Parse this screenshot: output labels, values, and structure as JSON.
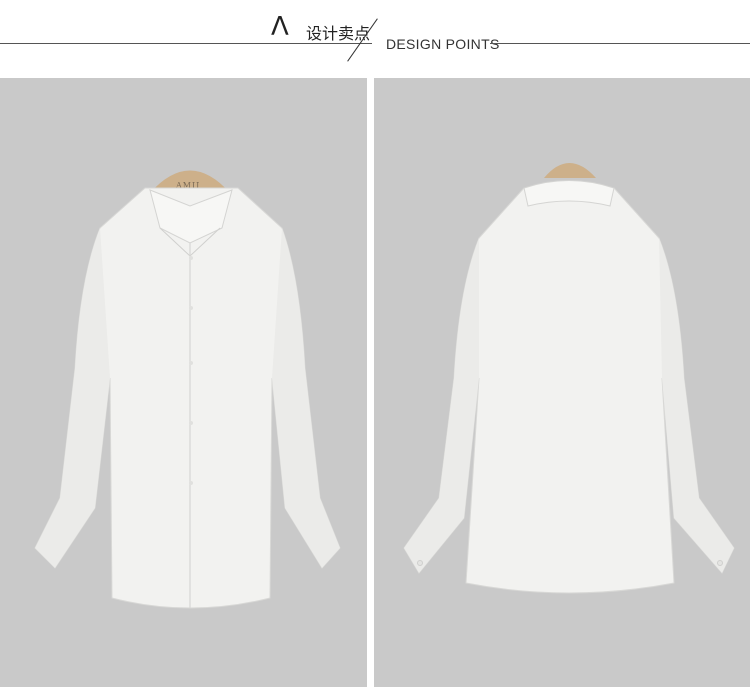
{
  "header": {
    "icon": "lambda-icon",
    "title_cn": "设计卖点",
    "title_en": "DESIGN  POINTS"
  },
  "images": {
    "front": {
      "description_icon": "shirt-front-icon",
      "hanger_brand": "AMII"
    },
    "back": {
      "description_icon": "shirt-back-icon"
    }
  },
  "colors": {
    "background_panel": "#c9c9c9",
    "shirt": "#f2f2f0",
    "hanger": "#cdb08a"
  }
}
